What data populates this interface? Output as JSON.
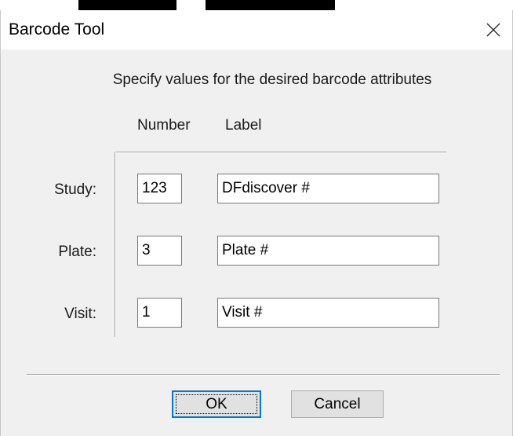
{
  "window": {
    "title": "Barcode Tool"
  },
  "icons": {
    "close": "close-icon"
  },
  "form": {
    "instructions": "Specify values for the desired barcode attributes",
    "column_headers": {
      "number": "Number",
      "label": "Label"
    },
    "rows": [
      {
        "name": "Study:",
        "number": "123",
        "label": "DFdiscover #"
      },
      {
        "name": "Plate:",
        "number": "3",
        "label": "Plate #"
      },
      {
        "name": "Visit:",
        "number": "1",
        "label": "Visit #"
      }
    ]
  },
  "buttons": {
    "ok": "OK",
    "cancel": "Cancel"
  },
  "colors": {
    "dialog_background": "#f0f0f0",
    "default_button_border": "#0078d7"
  }
}
